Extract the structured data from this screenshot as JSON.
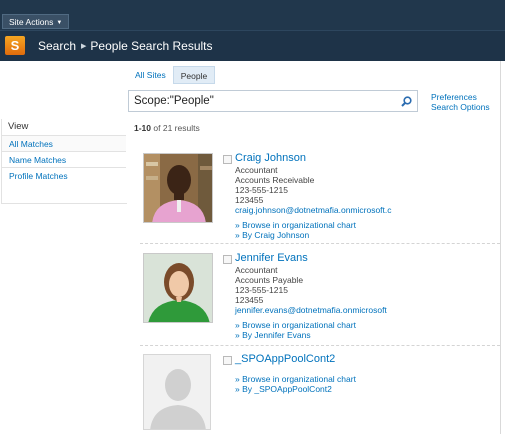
{
  "top": {
    "site_actions": "Site Actions"
  },
  "header": {
    "logo": "S",
    "crumb_root": "Search",
    "crumb_current": "People Search Results"
  },
  "tabs": [
    {
      "label": "All Sites"
    },
    {
      "label": "People"
    }
  ],
  "search": {
    "value": "Scope:\"People\""
  },
  "preferences": {
    "line1": "Preferences",
    "line2": "Search Options"
  },
  "refiner": {
    "title": "View",
    "items": [
      {
        "label": "All Matches"
      },
      {
        "label": "Name Matches"
      },
      {
        "label": "Profile Matches"
      }
    ]
  },
  "results_count": {
    "range": "1-10",
    "suffix": "of 21 results"
  },
  "results": [
    {
      "name": "Craig Johnson",
      "title": "Accountant",
      "department": "Accounts Receivable",
      "phone": "123-555-1215",
      "extension": "123455",
      "email": "craig.johnson@dotnetmafia.onmicrosoft.c",
      "link1": "» Browse in organizational chart",
      "link2": "» By Craig Johnson"
    },
    {
      "name": "Jennifer Evans",
      "title": "Accountant",
      "department": "Accounts Payable",
      "phone": "123-555-1215",
      "extension": "123455",
      "email": "jennifer.evans@dotnetmafia.onmicrosoft",
      "link1": "» Browse in organizational chart",
      "link2": "» By Jennifer Evans"
    },
    {
      "name": "_SPOAppPoolCont2",
      "link1": "» Browse in organizational chart",
      "link2": "» By _SPOAppPoolCont2"
    }
  ]
}
